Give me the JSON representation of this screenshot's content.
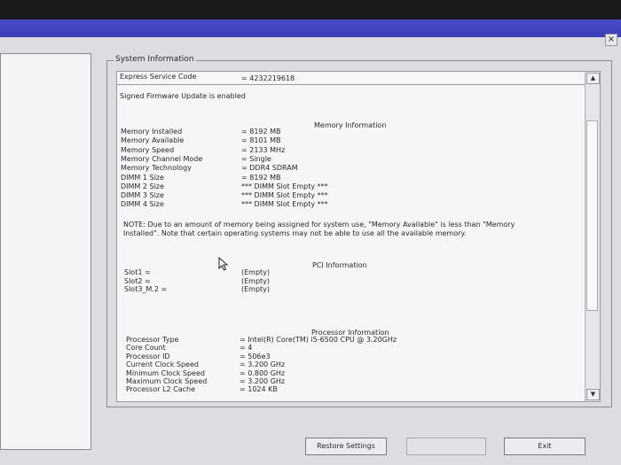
{
  "window": {
    "close_glyph": "×"
  },
  "group_title": "System Information",
  "service_tag": {
    "label": "Express Service Code",
    "value": "= 4232219618"
  },
  "firmware_note": "Signed Firmware Update is enabled",
  "memory": {
    "heading": "Memory Information",
    "rows": [
      {
        "label": "Memory Installed",
        "value": "= 8192 MB"
      },
      {
        "label": "Memory Available",
        "value": "= 8101 MB"
      },
      {
        "label": "Memory Speed",
        "value": "= 2133 MHz"
      },
      {
        "label": "Memory Channel Mode",
        "value": "= Single"
      },
      {
        "label": "Memory Technology",
        "value": "= DDR4 SDRAM"
      },
      {
        "label": "DIMM 1 Size",
        "value": "= 8192 MB"
      },
      {
        "label": "DIMM 2 Size",
        "value": "*** DIMM Slot Empty ***"
      },
      {
        "label": "DIMM 3 Size",
        "value": "*** DIMM Slot Empty ***"
      },
      {
        "label": "DIMM 4 Size",
        "value": "*** DIMM Slot Empty ***"
      }
    ],
    "note": "NOTE: Due to an amount of memory being assigned for system use, \"Memory Available\" is less than \"Memory Installed\". Note that certain operating systems may not be able to use all the available memory."
  },
  "pci": {
    "heading": "PCI Information",
    "rows": [
      {
        "label": "Slot1 =",
        "value": "(Empty)"
      },
      {
        "label": "Slot2 =",
        "value": "(Empty)"
      },
      {
        "label": "Slot3_M.2 =",
        "value": "(Empty)"
      }
    ]
  },
  "processor": {
    "heading": "Processor Information",
    "rows": [
      {
        "label": "Processor Type",
        "value": "= Intel(R) Core(TM) i5-6500 CPU @ 3.20GHz"
      },
      {
        "label": "Core Count",
        "value": "= 4"
      },
      {
        "label": "Processor ID",
        "value": "= 506e3"
      },
      {
        "label": "Current Clock Speed",
        "value": "= 3.200 GHz"
      },
      {
        "label": "Minimum Clock Speed",
        "value": "= 0.800 GHz"
      },
      {
        "label": "Maximum Clock Speed",
        "value": "= 3.200 GHz"
      },
      {
        "label": "Processor L2 Cache",
        "value": "= 1024 KB"
      }
    ]
  },
  "scroll": {
    "up_glyph": "▲",
    "down_glyph": "▼"
  },
  "buttons": {
    "restore": "Restore Settings",
    "exit": "Exit"
  },
  "colors": {
    "titlebar": "#3b3eb6",
    "panel": "#f6f6f8",
    "background": "#dcdce2"
  }
}
